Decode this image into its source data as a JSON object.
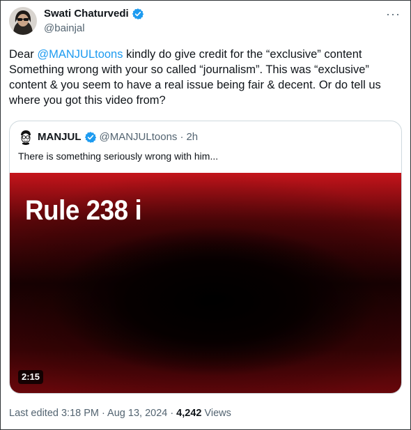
{
  "author": {
    "name": "Swati Chaturvedi",
    "handle": "@bainjal",
    "verified": true
  },
  "menu": {
    "more_label": "···"
  },
  "tweet": {
    "prefix": "Dear ",
    "mention": "@MANJULtoons",
    "body": " kindly do give credit for the “exclusive” content Something wrong with your so called “journalism”. This was “exclusive” content & you seem to have a real issue being fair & decent. Or do tell us where you got this video from?"
  },
  "quoted": {
    "name": "MANJUL",
    "handle": "@MANJULtoons",
    "separator": "·",
    "time": "2h",
    "text": "There is something seriously wrong with him...",
    "media": {
      "overlay_title": "Rule 238 i",
      "duration": "2:15"
    }
  },
  "footer": {
    "edited": "Last edited 3:18 PM · Aug 13, 2024",
    "separator": "·",
    "views_count": "4,242",
    "views_label": "Views"
  },
  "colors": {
    "accent": "#1d9bf0",
    "text": "#0f1419",
    "muted": "#536471",
    "border": "#cfd9de"
  }
}
